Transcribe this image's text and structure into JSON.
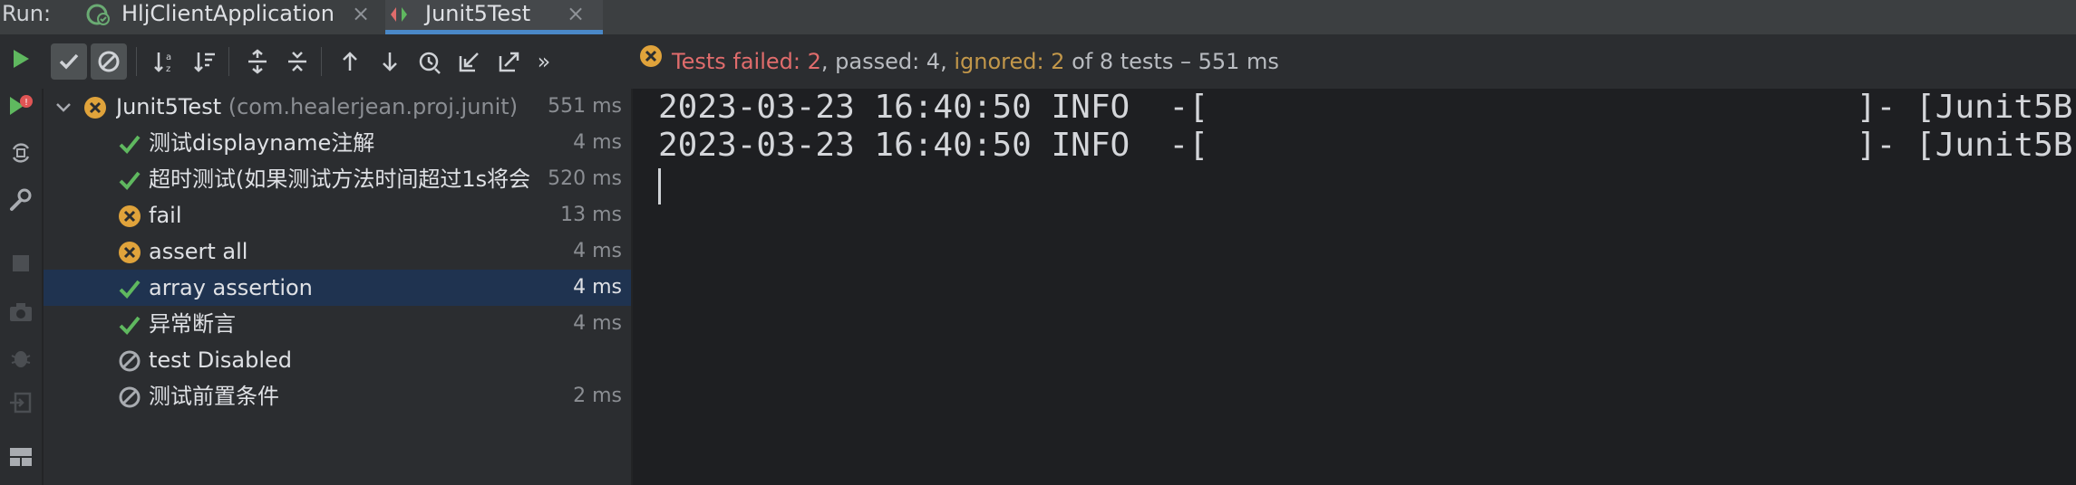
{
  "run_label": "Run:",
  "tabs": [
    {
      "label": "HljClientApplication",
      "close": "×"
    },
    {
      "label": "Junit5Test",
      "close": "×"
    }
  ],
  "status": {
    "failed_text": "Tests failed: 2",
    "passed_text": ", passed: 4, ",
    "ignored_text": "ignored: 2",
    "rest_text": " of 8 tests – 551 ms"
  },
  "overflow_label": "»",
  "tree": {
    "root": {
      "label": "Junit5Test",
      "sub": "(com.healerjean.proj.junit)",
      "time": "551 ms",
      "status": "failed"
    },
    "items": [
      {
        "label": "测试displayname注解",
        "time": "4 ms",
        "status": "passed"
      },
      {
        "label": "超时测试(如果测试方法时间超过1s将会",
        "time": "520 ms",
        "status": "passed"
      },
      {
        "label": "fail",
        "time": "13 ms",
        "status": "failed"
      },
      {
        "label": "assert all",
        "time": "4 ms",
        "status": "failed"
      },
      {
        "label": "array assertion",
        "time": "4 ms",
        "status": "passed"
      },
      {
        "label": "异常断言",
        "time": "4 ms",
        "status": "passed"
      },
      {
        "label": "test Disabled",
        "time": "",
        "status": "ignored"
      },
      {
        "label": "测试前置条件",
        "time": "2 ms",
        "status": "ignored"
      }
    ]
  },
  "console": {
    "lines": [
      {
        "left": "2023-03-23 16:40:50 INFO  -[",
        "right": "]- [Junit5B"
      },
      {
        "left": "2023-03-23 16:40:50 INFO  -[",
        "right": "]- [Junit5B"
      }
    ]
  },
  "colors": {
    "pass": "#5fb85f",
    "fail": "#e0a33b",
    "fail_text": "#e06c6c",
    "ignored_text": "#c2974a",
    "selection": "#1f3350",
    "accent": "#4a88c7"
  }
}
